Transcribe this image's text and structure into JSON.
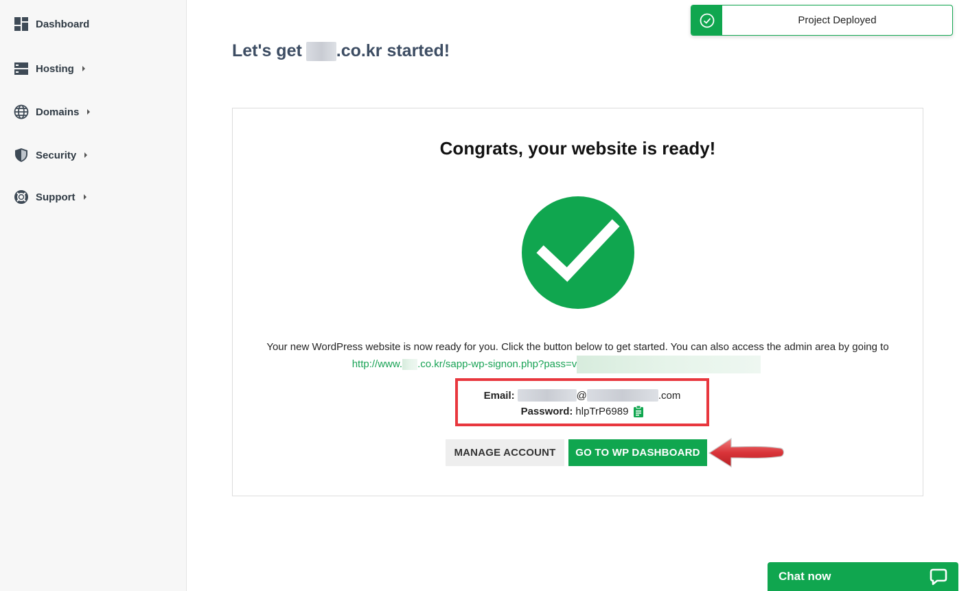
{
  "sidebar": {
    "items": [
      {
        "label": "Dashboard",
        "icon": "dashboard-icon",
        "has_submenu": false
      },
      {
        "label": "Hosting",
        "icon": "server-icon",
        "has_submenu": true
      },
      {
        "label": "Domains",
        "icon": "globe-icon",
        "has_submenu": true
      },
      {
        "label": "Security",
        "icon": "shield-icon",
        "has_submenu": true
      },
      {
        "label": "Support",
        "icon": "lifebuoy-icon",
        "has_submenu": true
      }
    ]
  },
  "header": {
    "title_prefix": "Let's get",
    "title_suffix": ".co.kr started!"
  },
  "card": {
    "heading": "Congrats, your website is ready!",
    "intro_text": "Your new WordPress website is now ready for you. Click the button below to get started. You can also access the admin area by going to",
    "link_prefix": "http://www.",
    "link_middle": ".co.kr/sapp-wp-signon.php?pass=v",
    "email_label": "Email:",
    "email_at": "@",
    "email_suffix": ".com",
    "password_label": "Password:",
    "password_value": "hlpTrP6989",
    "manage_button": "MANAGE ACCOUNT",
    "wp_button": "GO TO WP DASHBOARD"
  },
  "toast": {
    "message": "Project Deployed",
    "icon": "check-circle-icon"
  },
  "chat": {
    "label": "Chat now",
    "icon": "chat-bubble-icon"
  },
  "colors": {
    "accent_green": "#10a64f",
    "highlight_red": "#e8373e",
    "title_text": "#3d4d63"
  }
}
